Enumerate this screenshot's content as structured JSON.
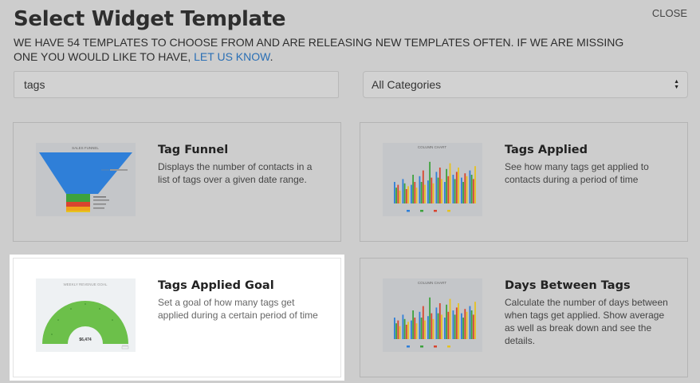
{
  "header": {
    "title": "Select Widget Template",
    "close_label": "CLOSE",
    "subtitle_text": "WE HAVE 54 TEMPLATES TO CHOOSE FROM AND ARE RELEASING NEW TEMPLATES OFTEN. IF WE ARE MISSING ONE YOU WOULD LIKE TO HAVE, ",
    "subtitle_link": "LET US KNOW",
    "subtitle_end": "."
  },
  "search": {
    "value": "tags"
  },
  "category_select": {
    "selected": "All Categories"
  },
  "colors": {
    "overlay_bg": "#cdcdcd",
    "link": "#2a6fb5",
    "funnel_blue": "#2f7fd8",
    "funnel_green": "#3da23d",
    "funnel_red": "#d9442e",
    "funnel_orange": "#f0a21b",
    "gauge_green": "#6cc04a"
  },
  "cards": [
    {
      "title": "Tag Funnel",
      "description": "Displays the number of contacts in a list of tags over a given date range.",
      "thumb_title": "SALES FUNNEL",
      "thumb_type": "funnel"
    },
    {
      "title": "Tags Applied",
      "description": "See how many tags get applied to contacts during a period of time",
      "thumb_title": "COLUMN CHART",
      "thumb_type": "column"
    },
    {
      "title": "Tags Applied Goal",
      "description": "Set a goal of how many tags get applied during a certain period of time",
      "thumb_title": "WEEKLY REVENUE GOAL",
      "thumb_value": "$6,474",
      "thumb_type": "gauge",
      "active": true
    },
    {
      "title": "Days Between Tags",
      "description": "Calculate the number of days between when tags get applied. Show average as well as break down and see the details.",
      "thumb_title": "COLUMN CHART",
      "thumb_type": "column"
    }
  ]
}
